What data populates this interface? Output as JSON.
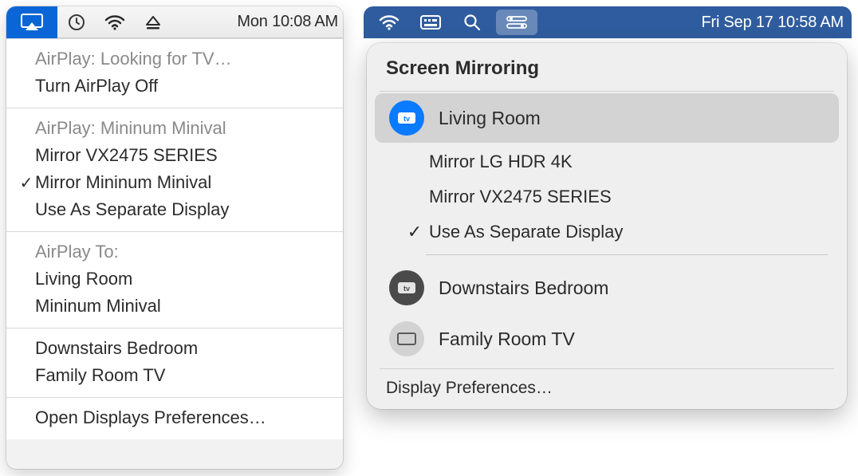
{
  "left": {
    "menubar": {
      "time": "Mon 10:08 AM"
    },
    "section1": {
      "header": "AirPlay: Looking for TV…",
      "turn_off": "Turn AirPlay Off"
    },
    "section2": {
      "header": "AirPlay: Mininum Minival",
      "mirror1": "Mirror VX2475 SERIES",
      "mirror2": "Mirror Mininum Minival",
      "separate": "Use As Separate Display"
    },
    "section3": {
      "header": "AirPlay To:",
      "dest1": "Living Room",
      "dest2": "Mininum Minival"
    },
    "section4": {
      "dev1": "Downstairs Bedroom",
      "dev2": "Family Room TV"
    },
    "section5": {
      "prefs": "Open Displays Preferences…"
    }
  },
  "right": {
    "menubar": {
      "time": "Fri Sep 17  10:58 AM"
    },
    "title": "Screen Mirroring",
    "selected": {
      "label": "Living Room"
    },
    "sub": {
      "mirror1": "Mirror LG HDR 4K",
      "mirror2": "Mirror VX2475 SERIES",
      "separate": "Use As Separate Display"
    },
    "devices": {
      "dev1": "Downstairs Bedroom",
      "dev2": "Family Room TV"
    },
    "footer": "Display Preferences…"
  }
}
